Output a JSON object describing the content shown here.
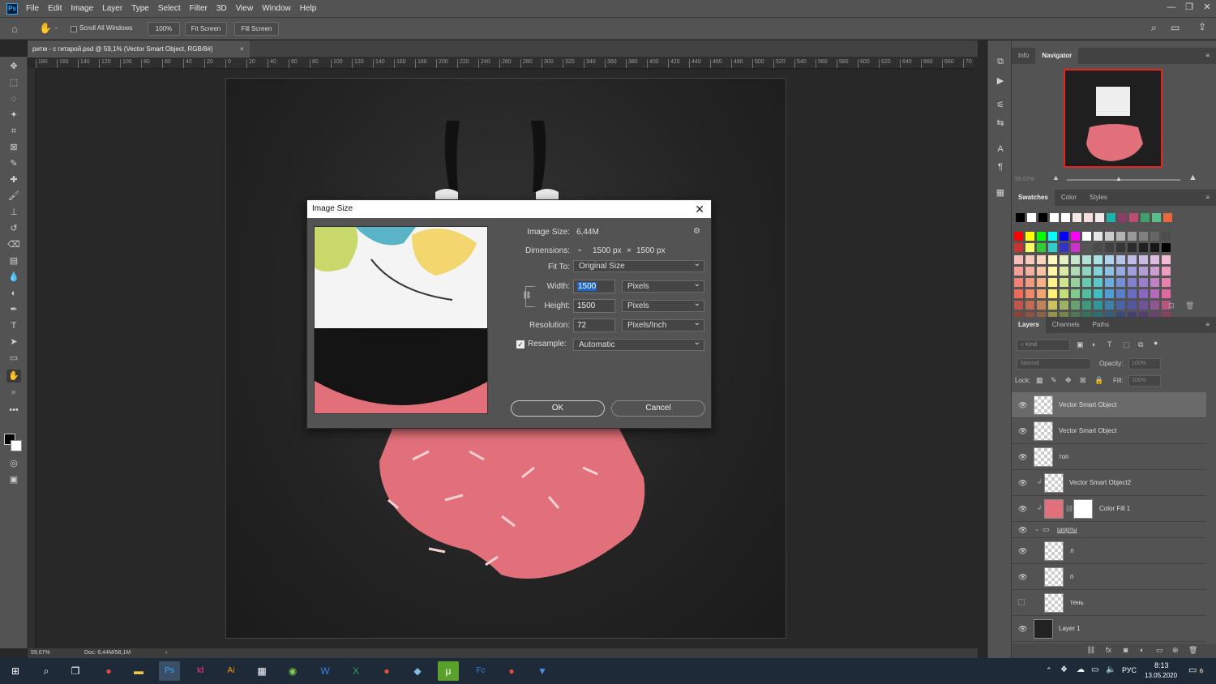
{
  "app": {
    "logo": "Ps",
    "menu": [
      "File",
      "Edit",
      "Image",
      "Layer",
      "Type",
      "Select",
      "Filter",
      "3D",
      "View",
      "Window",
      "Help"
    ],
    "window_controls": [
      "—",
      "❐",
      "✕"
    ]
  },
  "options_bar": {
    "scroll_all_label": "Scroll All Windows",
    "zoom_btn": "100%",
    "fit_btn": "Fit Screen",
    "fill_btn": "Fill Screen"
  },
  "document": {
    "tab_title": "ритм - с гитарой.psd @ 59,1% (Vector Smart Object, RGB/8#)",
    "tab_close": "×",
    "status_zoom": "59,07%",
    "status_doc": "Doc: 6,44M/58,1M",
    "status_arrow": "›"
  },
  "ruler": {
    "h_labels": [
      "180",
      "160",
      "140",
      "120",
      "100",
      "80",
      "60",
      "40",
      "20",
      "0",
      "20",
      "40",
      "60",
      "80",
      "100",
      "120",
      "140",
      "160",
      "180",
      "200",
      "220",
      "240",
      "260",
      "280",
      "300",
      "320",
      "340",
      "360",
      "380",
      "400",
      "420",
      "440",
      "460",
      "480",
      "500",
      "520",
      "540",
      "560",
      "580",
      "600",
      "620",
      "640",
      "660",
      "680",
      "70"
    ]
  },
  "dialog": {
    "title": "Image Size",
    "close": "✕",
    "image_size_label": "Image Size:",
    "image_size_value": "6,44M",
    "dimensions_label": "Dimensions:",
    "dimensions_w": "1500 px",
    "dimensions_x": "×",
    "dimensions_h": "1500 px",
    "fit_to_label": "Fit To:",
    "fit_to_value": "Original Size",
    "width_label": "Width:",
    "width_value": "1500",
    "width_unit": "Pixels",
    "height_label": "Height:",
    "height_value": "1500",
    "height_unit": "Pixels",
    "resolution_label": "Resolution:",
    "resolution_value": "72",
    "resolution_unit": "Pixels/Inch",
    "resample_label": "Resample:",
    "resample_value": "Automatic",
    "ok_label": "OK",
    "cancel_label": "Cancel"
  },
  "navigator": {
    "tabs": [
      "Info",
      "Navigator"
    ],
    "zoom": "59,07%"
  },
  "swatches": {
    "tabs": [
      "Swatches",
      "Color",
      "Styles"
    ],
    "recent": [
      "#000000",
      "#ffffff",
      "#000000",
      "#ffffff",
      "#ffffff",
      "#f4e9e4",
      "#f9dcdc",
      "#f1eaea",
      "#20b1ad",
      "#8a3f66",
      "#be4e6f",
      "#3fa06c",
      "#5cbf8a",
      "#e86a3c"
    ],
    "row1": [
      "#ff0000",
      "#ffff00",
      "#00ff00",
      "#00ffff",
      "#0000ff",
      "#ff00ff",
      "#ffffff",
      "#e6e6e6",
      "#cccccc",
      "#b3b3b3",
      "#999999",
      "#808080",
      "#666666",
      "#4d4d4d"
    ],
    "row2": [
      "#cc3333",
      "#ffff66",
      "#33cc33",
      "#33cccc",
      "#3333cc",
      "#cc33cc",
      "#555555",
      "#4a4a4a",
      "#404040",
      "#363636",
      "#2b2b2b",
      "#202020",
      "#161616",
      "#000000"
    ],
    "grid_hues": [
      "#f06a5c",
      "#f0876a",
      "#f5a36e",
      "#fff275",
      "#c4df7a",
      "#82c98d",
      "#4fbf9f",
      "#3fbcc4",
      "#4f9fd6",
      "#5c7ccd",
      "#6b6bc7",
      "#8b66c0",
      "#b46ab9",
      "#e36aa0"
    ]
  },
  "layers": {
    "tabs": [
      "Layers",
      "Channels",
      "Paths"
    ],
    "kind_placeholder": "Kind",
    "blend_mode": "Normal",
    "opacity_label": "Opacity:",
    "opacity_value": "100%",
    "lock_label": "Lock:",
    "fill_label": "Fill:",
    "fill_value": "100%",
    "items": [
      {
        "name": "Vector Smart Object",
        "selected": true,
        "visible": true
      },
      {
        "name": "Vector Smart Object",
        "selected": false,
        "visible": true
      },
      {
        "name": "топ",
        "selected": false,
        "visible": true
      },
      {
        "name": "Vector Smart Object2",
        "selected": false,
        "visible": true
      },
      {
        "name": "Color Fill 1",
        "selected": false,
        "visible": true
      },
      {
        "name": "шорты",
        "selected": false,
        "visible": true
      },
      {
        "name": "л",
        "selected": false,
        "visible": true
      },
      {
        "name": "п",
        "selected": false,
        "visible": true
      },
      {
        "name": "тень",
        "selected": false,
        "visible": false
      },
      {
        "name": "Layer 1",
        "selected": false,
        "visible": true
      }
    ]
  },
  "taskbar": {
    "lang": "РУС",
    "time": "8:13",
    "date": "13.05.2020",
    "notifications": "6"
  }
}
